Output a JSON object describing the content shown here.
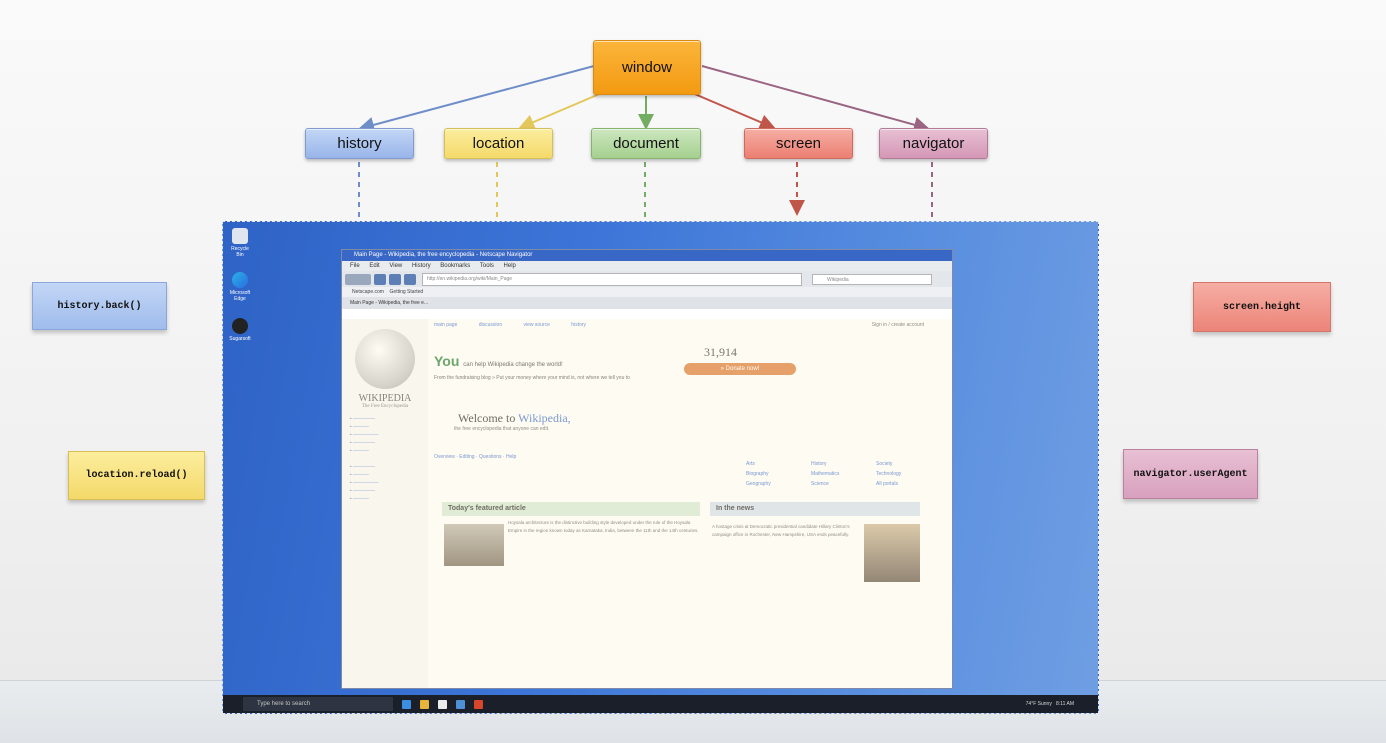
{
  "diagram": {
    "root": {
      "label": "window"
    },
    "children": [
      {
        "key": "history",
        "label": "history"
      },
      {
        "key": "location",
        "label": "location"
      },
      {
        "key": "document",
        "label": "document"
      },
      {
        "key": "screen",
        "label": "screen"
      },
      {
        "key": "navigator",
        "label": "navigator"
      }
    ],
    "notes": {
      "history_back": "history.back()",
      "location_reload": "location.reload()",
      "screen_height": "screen.height",
      "navigator_user_agent": "navigator.userAgent"
    },
    "colors": {
      "window": "#f5a21f",
      "history": "#a9c3ef",
      "location": "#f8e48e",
      "document": "#b9dca8",
      "screen": "#f0968a",
      "navigator": "#dca9c3",
      "line_history": "#6f8ec9",
      "line_location": "#e4c75a",
      "line_document": "#73ad62",
      "line_screen": "#c0564a",
      "line_navigator": "#9a6483"
    }
  },
  "desktop": {
    "icons": [
      "Recycle Bin",
      "Microsoft Edge",
      "Sugarsoft"
    ],
    "taskbar": {
      "search_placeholder": "Type here to search",
      "weather": "74°F Sunny",
      "time": "8:11 AM"
    }
  },
  "browser": {
    "title": "Main Page - Wikipedia, the free encyclopedia - Netscape Navigator",
    "menu": [
      "File",
      "Edit",
      "View",
      "History",
      "Bookmarks",
      "Tools",
      "Help"
    ],
    "bookmarks": [
      "Netscape.com",
      "Getting Started"
    ],
    "tab": "Main Page - Wikipedia, the free e...",
    "search_placeholder": "Wikipedia",
    "url": "http://en.wikipedia.org/wiki/Main_Page"
  },
  "wikipedia": {
    "logo_text": "WIKIPEDIA",
    "tagline": "The Free Encyclopedia",
    "tabs": [
      "main page",
      "discussion",
      "view source",
      "history"
    ],
    "sign_in": "Sign in / create account",
    "you": "You",
    "you_tail": "can help Wikipedia change the world!",
    "count": "31,914",
    "donate": "» Donate now!",
    "blog_line": "From the fundraising blog » Put your money where your mind is, not where we tell you to",
    "welcome_prefix": "Welcome to ",
    "welcome_link": "Wikipedia,",
    "welcome_sub": "the free encyclopedia that anyone can edit.",
    "cats": [
      "Arts",
      "Biography",
      "Geography",
      "History",
      "Mathematics",
      "Science",
      "Society",
      "Technology",
      "All portals"
    ],
    "foot_links": "Overview · Editing · Questions · Help",
    "featured_heading": "Today's featured article",
    "featured_text": "Hoysala architecture is the distinctive building style developed under the rule of the Hoysala Empire in the region known today as Karnataka, India, between the 11th and the 14th centuries.",
    "news_heading": "In the news",
    "news_text": "A hostage crisis at Democratic presidential candidate Hillary Clinton's campaign office in Rochester, New Hampshire, USA ends peacefully."
  }
}
